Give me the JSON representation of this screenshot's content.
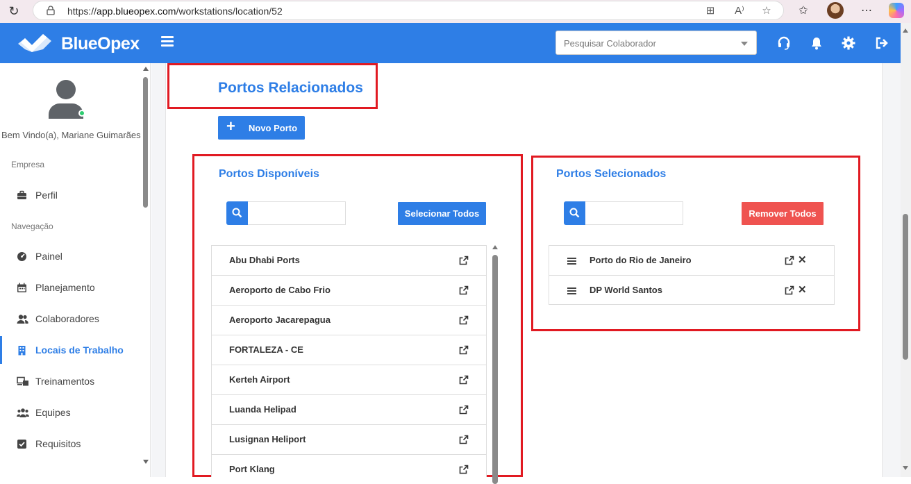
{
  "browser": {
    "url_prefix": "https://",
    "url_host": "app.blueopex.com",
    "url_path": "/workstations/location/52"
  },
  "header": {
    "brand": "BlueOpex",
    "search_placeholder": "Pesquisar Colaborador",
    "colors": {
      "primary": "#2e7ee6",
      "danger": "#ef5350",
      "highlight": "#e11a22"
    }
  },
  "sidebar": {
    "welcome": "Bem Vindo(a), Mariane Guimarães",
    "section_empresa": "Empresa",
    "section_navegacao": "Navegação",
    "items": [
      {
        "label": "Perfil",
        "icon": "briefcase-icon"
      },
      {
        "label": "Painel",
        "icon": "dashboard-icon"
      },
      {
        "label": "Planejamento",
        "icon": "calendar-icon"
      },
      {
        "label": "Colaboradores",
        "icon": "users-icon"
      },
      {
        "label": "Locais de Trabalho",
        "icon": "building-icon",
        "active": true
      },
      {
        "label": "Treinamentos",
        "icon": "training-icon"
      },
      {
        "label": "Equipes",
        "icon": "team-icon"
      },
      {
        "label": "Requisitos",
        "icon": "checkbox-icon"
      }
    ]
  },
  "main": {
    "title": "Portos Relacionados",
    "new_button": "Novo Porto",
    "available": {
      "title": "Portos Disponíveis",
      "select_all": "Selecionar Todos",
      "items": [
        "Abu Dhabi Ports",
        "Aeroporto de Cabo Frio",
        "Aeroporto Jacarepagua",
        "FORTALEZA - CE",
        "Kerteh Airport",
        "Luanda Helipad",
        "Lusignan Heliport",
        "Port Klang"
      ]
    },
    "selected": {
      "title": "Portos Selecionados",
      "remove_all": "Remover Todos",
      "items": [
        "Porto do Rio de Janeiro",
        "DP World Santos"
      ]
    }
  }
}
